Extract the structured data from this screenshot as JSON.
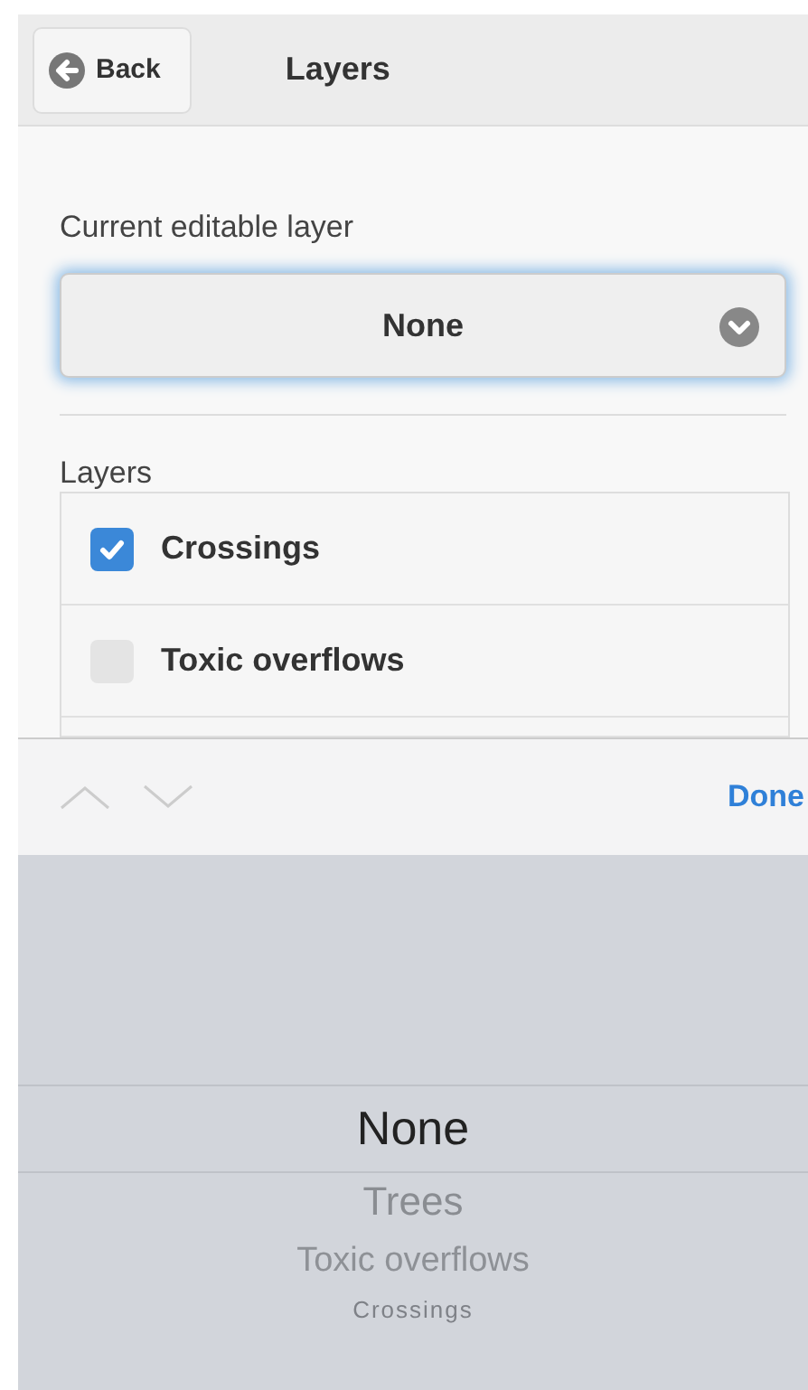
{
  "header": {
    "back_label": "Back",
    "title": "Layers"
  },
  "editable_layer": {
    "label": "Current editable layer",
    "value": "None",
    "focused": true
  },
  "layers": {
    "label": "Layers",
    "items": [
      {
        "name": "Crossings",
        "checked": true
      },
      {
        "name": "Toxic overflows",
        "checked": false
      }
    ]
  },
  "keyboard_toolbar": {
    "done_label": "Done"
  },
  "picker": {
    "items": [
      {
        "label": "None",
        "selected": true
      },
      {
        "label": "Trees",
        "selected": false
      },
      {
        "label": "Toxic overflows",
        "selected": false
      },
      {
        "label": "Crossings",
        "selected": false
      }
    ]
  }
}
